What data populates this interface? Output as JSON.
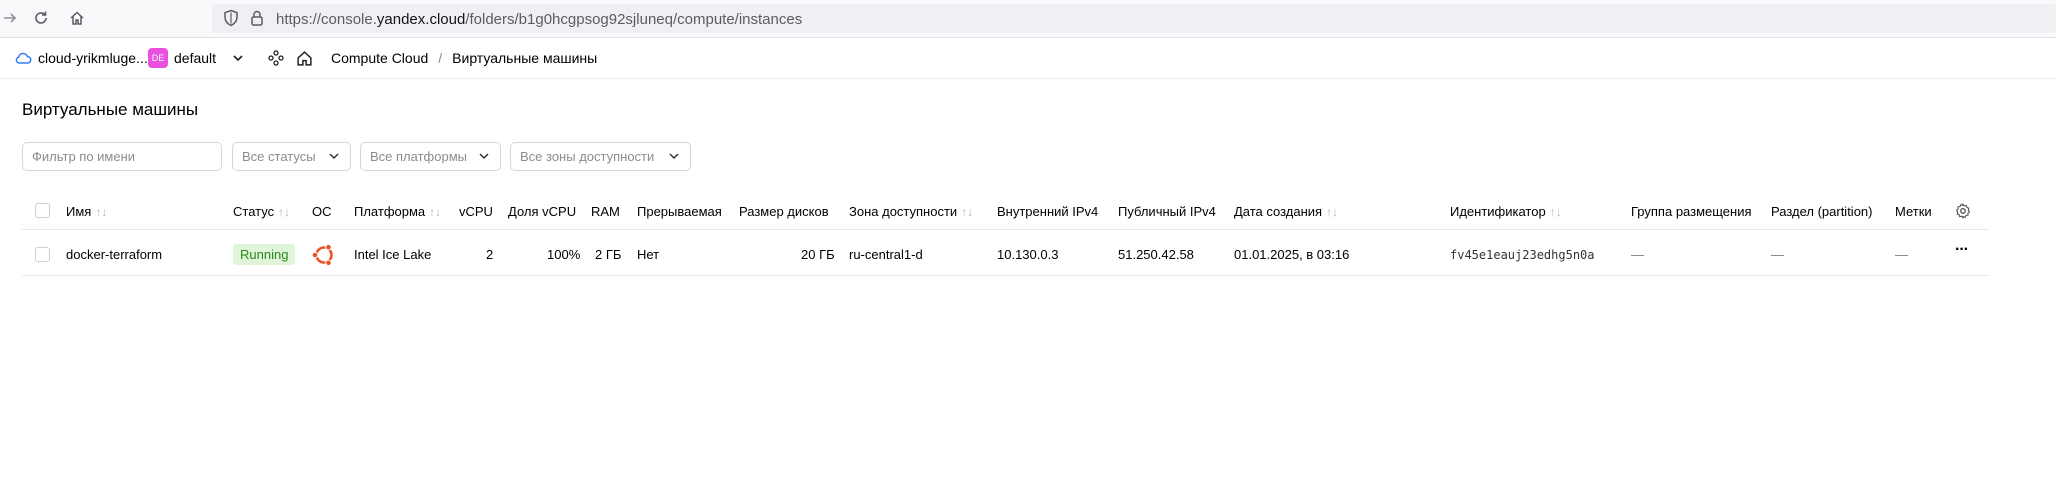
{
  "browser": {
    "url_prefix": "https://console.",
    "url_domain": "yandex.cloud",
    "url_path": "/folders/b1g0hcgpsog92sjluneq/compute/instances"
  },
  "header": {
    "cloud_name": "cloud-yrikmluge...",
    "folder_badge": "DE",
    "folder_name": "default",
    "breadcrumb_service": "Compute Cloud",
    "breadcrumb_sep": "/",
    "breadcrumb_current": "Виртуальные машины"
  },
  "page": {
    "title": "Виртуальные машины",
    "filters": {
      "name_placeholder": "Фильтр по имени",
      "status": "Все статусы",
      "platform": "Все платформы",
      "zone": "Все зоны доступности"
    }
  },
  "table": {
    "columns": {
      "name": "Имя",
      "status": "Статус",
      "os": "ОС",
      "platform": "Платформа",
      "vcpu": "vCPU",
      "vcpu_share": "Доля vCPU",
      "ram": "RAM",
      "preemptible": "Прерываемая",
      "disk_size": "Размер дисков",
      "zone": "Зона доступности",
      "internal_ip": "Внутренний IPv4",
      "public_ip": "Публичный IPv4",
      "created": "Дата создания",
      "id": "Идентификатор",
      "placement_group": "Группа размещения",
      "partition": "Раздел (partition)",
      "labels": "Метки"
    },
    "sort_glyph": "↑↓",
    "rows": [
      {
        "name": "docker-terraform",
        "status": "Running",
        "os": "ubuntu",
        "platform": "Intel Ice Lake",
        "vcpu": "2",
        "vcpu_share": "100%",
        "ram": "2 ГБ",
        "preemptible": "Нет",
        "disk_size": "20 ГБ",
        "zone": "ru-central1-d",
        "internal_ip": "10.130.0.3",
        "public_ip": "51.250.42.58",
        "created": "01.01.2025, в 03:16",
        "id": "fv45e1eauj23edhg5n0a",
        "placement_group": "—",
        "partition": "—",
        "labels": "—",
        "actions": "···"
      }
    ]
  },
  "colors": {
    "running_bg": "#dff4d9",
    "running_text": "#2a8a1e",
    "folder_badge": "#e94fe1",
    "ubuntu": "#e95420"
  }
}
